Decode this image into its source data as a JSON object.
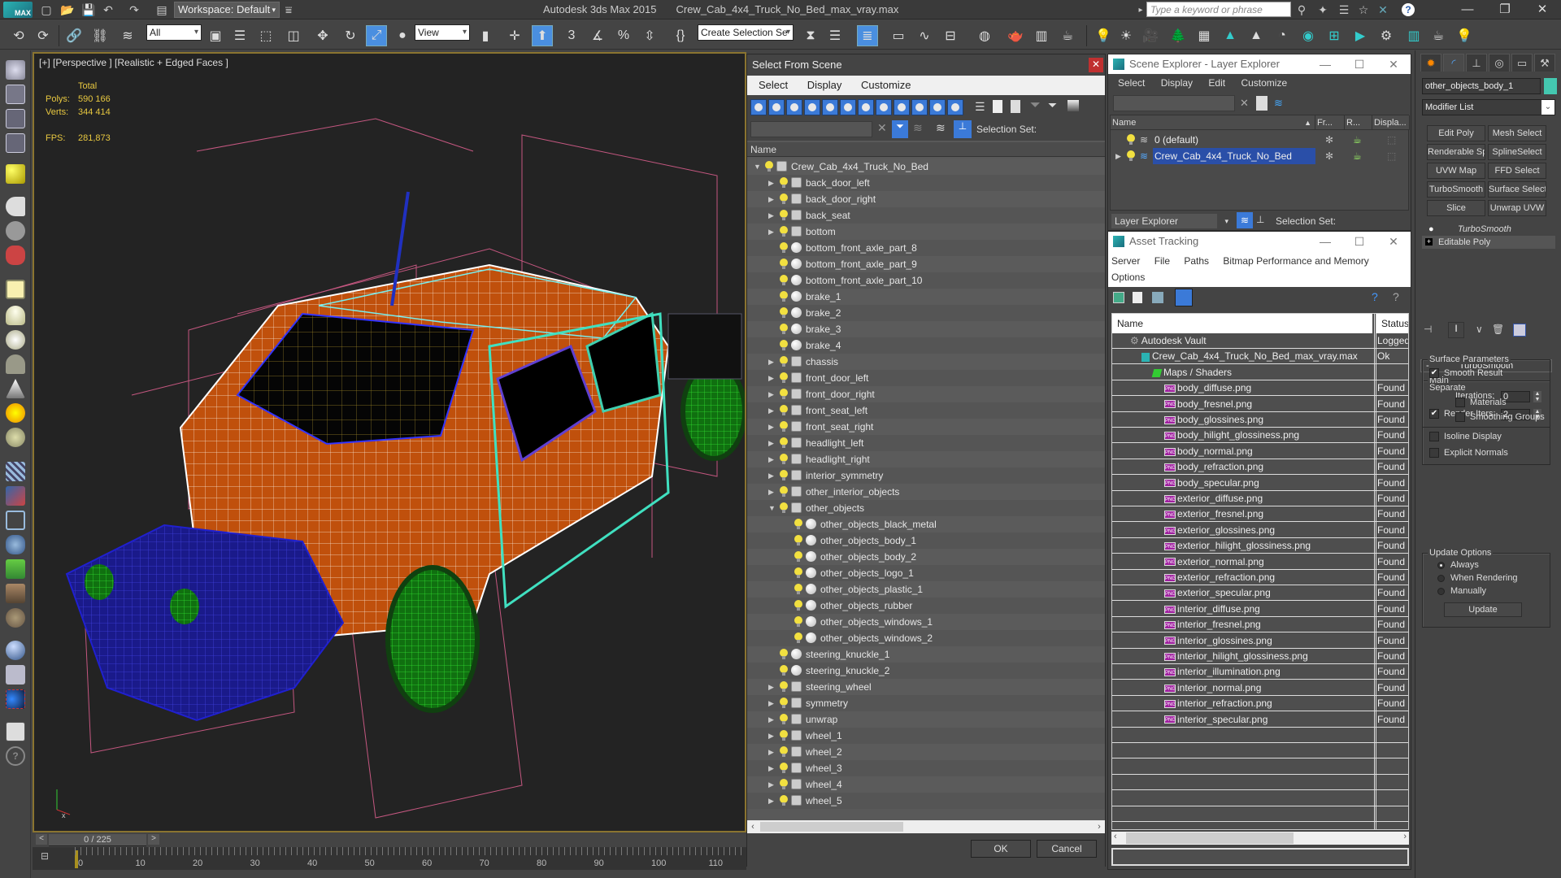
{
  "titlebar": {
    "workspace": "Workspace: Default",
    "app_name": "Autodesk 3ds Max  2015",
    "file_name": "Crew_Cab_4x4_Truck_No_Bed_max_vray.max",
    "search_placeholder": "Type a keyword or phrase",
    "logo_text": "MAX"
  },
  "toolbar": {
    "selection_filter": "All",
    "ref_coord": "View",
    "selection_set": "Create Selection Se"
  },
  "viewport": {
    "label": "[+] [Perspective ] [Realistic + Edged Faces ]",
    "stats_header": "Total",
    "polys_label": "Polys:",
    "polys_value": "590 166",
    "verts_label": "Verts:",
    "verts_value": "344 414",
    "fps_label": "FPS:",
    "fps_value": "281,873"
  },
  "timeline": {
    "frame_counter": "0 / 225",
    "ticks": [
      "0",
      "10",
      "20",
      "30",
      "40",
      "50",
      "60",
      "70",
      "80",
      "90",
      "100",
      "110"
    ]
  },
  "select_from_scene": {
    "title": "Select From Scene",
    "menu": [
      "Select",
      "Display",
      "Customize"
    ],
    "selection_set_label": "Selection Set:",
    "column_name": "Name",
    "ok_label": "OK",
    "cancel_label": "Cancel",
    "tree": [
      {
        "label": "Crew_Cab_4x4_Truck_No_Bed",
        "depth": 0,
        "expander": "open",
        "icon": "group"
      },
      {
        "label": "back_door_left",
        "depth": 1,
        "expander": "closed",
        "icon": "group"
      },
      {
        "label": "back_door_right",
        "depth": 1,
        "expander": "closed",
        "icon": "group"
      },
      {
        "label": "back_seat",
        "depth": 1,
        "expander": "closed",
        "icon": "group"
      },
      {
        "label": "bottom",
        "depth": 1,
        "expander": "closed",
        "icon": "group"
      },
      {
        "label": "bottom_front_axle_part_8",
        "depth": 1,
        "expander": "none",
        "icon": "sphere"
      },
      {
        "label": "bottom_front_axle_part_9",
        "depth": 1,
        "expander": "none",
        "icon": "sphere"
      },
      {
        "label": "bottom_front_axle_part_10",
        "depth": 1,
        "expander": "none",
        "icon": "sphere"
      },
      {
        "label": "brake_1",
        "depth": 1,
        "expander": "none",
        "icon": "sphere"
      },
      {
        "label": "brake_2",
        "depth": 1,
        "expander": "none",
        "icon": "sphere"
      },
      {
        "label": "brake_3",
        "depth": 1,
        "expander": "none",
        "icon": "sphere"
      },
      {
        "label": "brake_4",
        "depth": 1,
        "expander": "none",
        "icon": "sphere"
      },
      {
        "label": "chassis",
        "depth": 1,
        "expander": "closed",
        "icon": "group"
      },
      {
        "label": "front_door_left",
        "depth": 1,
        "expander": "closed",
        "icon": "group"
      },
      {
        "label": "front_door_right",
        "depth": 1,
        "expander": "closed",
        "icon": "group"
      },
      {
        "label": "front_seat_left",
        "depth": 1,
        "expander": "closed",
        "icon": "group"
      },
      {
        "label": "front_seat_right",
        "depth": 1,
        "expander": "closed",
        "icon": "group"
      },
      {
        "label": "headlight_left",
        "depth": 1,
        "expander": "closed",
        "icon": "group"
      },
      {
        "label": "headlight_right",
        "depth": 1,
        "expander": "closed",
        "icon": "group"
      },
      {
        "label": "interior_symmetry",
        "depth": 1,
        "expander": "closed",
        "icon": "group"
      },
      {
        "label": "other_interior_objects",
        "depth": 1,
        "expander": "closed",
        "icon": "group"
      },
      {
        "label": "other_objects",
        "depth": 1,
        "expander": "open",
        "icon": "group"
      },
      {
        "label": "other_objects_black_metal",
        "depth": 2,
        "expander": "none",
        "icon": "sphere"
      },
      {
        "label": "other_objects_body_1",
        "depth": 2,
        "expander": "none",
        "icon": "sphere"
      },
      {
        "label": "other_objects_body_2",
        "depth": 2,
        "expander": "none",
        "icon": "sphere"
      },
      {
        "label": "other_objects_logo_1",
        "depth": 2,
        "expander": "none",
        "icon": "sphere"
      },
      {
        "label": "other_objects_plastic_1",
        "depth": 2,
        "expander": "none",
        "icon": "sphere"
      },
      {
        "label": "other_objects_rubber",
        "depth": 2,
        "expander": "none",
        "icon": "sphere"
      },
      {
        "label": "other_objects_windows_1",
        "depth": 2,
        "expander": "none",
        "icon": "sphere"
      },
      {
        "label": "other_objects_windows_2",
        "depth": 2,
        "expander": "none",
        "icon": "sphere"
      },
      {
        "label": "steering_knuckle_1",
        "depth": 1,
        "expander": "none",
        "icon": "sphere"
      },
      {
        "label": "steering_knuckle_2",
        "depth": 1,
        "expander": "none",
        "icon": "sphere"
      },
      {
        "label": "steering_wheel",
        "depth": 1,
        "expander": "closed",
        "icon": "group"
      },
      {
        "label": "symmetry",
        "depth": 1,
        "expander": "closed",
        "icon": "group"
      },
      {
        "label": "unwrap",
        "depth": 1,
        "expander": "closed",
        "icon": "group"
      },
      {
        "label": "wheel_1",
        "depth": 1,
        "expander": "closed",
        "icon": "group"
      },
      {
        "label": "wheel_2",
        "depth": 1,
        "expander": "closed",
        "icon": "group"
      },
      {
        "label": "wheel_3",
        "depth": 1,
        "expander": "closed",
        "icon": "group"
      },
      {
        "label": "wheel_4",
        "depth": 1,
        "expander": "closed",
        "icon": "group"
      },
      {
        "label": "wheel_5",
        "depth": 1,
        "expander": "closed",
        "icon": "group"
      }
    ]
  },
  "scene_explorer": {
    "title": "Scene Explorer - Layer Explorer",
    "menu": [
      "Select",
      "Display",
      "Edit",
      "Customize"
    ],
    "columns": [
      "Name",
      "Fr...",
      "R...",
      "Displa..."
    ],
    "rows": [
      {
        "label": "0 (default)",
        "selected": false
      },
      {
        "label": "Crew_Cab_4x4_Truck_No_Bed",
        "selected": true
      }
    ],
    "layer_select": "Layer Explorer",
    "selection_set_label": "Selection Set:"
  },
  "asset_tracking": {
    "title": "Asset Tracking",
    "menu": [
      "Server",
      "File",
      "Paths",
      "Bitmap Performance and Memory",
      "Options"
    ],
    "columns": [
      "Name",
      "Status"
    ],
    "rows": [
      {
        "name": "Autodesk Vault",
        "status": "Logged",
        "depth": 0,
        "icon": "vault"
      },
      {
        "name": "Crew_Cab_4x4_Truck_No_Bed_max_vray.max",
        "status": "Ok",
        "depth": 1,
        "icon": "max"
      },
      {
        "name": "Maps / Shaders",
        "status": "",
        "depth": 2,
        "icon": "maps"
      },
      {
        "name": "body_diffuse.png",
        "status": "Found",
        "depth": 3,
        "icon": "png"
      },
      {
        "name": "body_fresnel.png",
        "status": "Found",
        "depth": 3,
        "icon": "png"
      },
      {
        "name": "body_glossines.png",
        "status": "Found",
        "depth": 3,
        "icon": "png"
      },
      {
        "name": "body_hilight_glossiness.png",
        "status": "Found",
        "depth": 3,
        "icon": "png"
      },
      {
        "name": "body_normal.png",
        "status": "Found",
        "depth": 3,
        "icon": "png"
      },
      {
        "name": "body_refraction.png",
        "status": "Found",
        "depth": 3,
        "icon": "png"
      },
      {
        "name": "body_specular.png",
        "status": "Found",
        "depth": 3,
        "icon": "png"
      },
      {
        "name": "exterior_diffuse.png",
        "status": "Found",
        "depth": 3,
        "icon": "png"
      },
      {
        "name": "exterior_fresnel.png",
        "status": "Found",
        "depth": 3,
        "icon": "png"
      },
      {
        "name": "exterior_glossines.png",
        "status": "Found",
        "depth": 3,
        "icon": "png"
      },
      {
        "name": "exterior_hilight_glossiness.png",
        "status": "Found",
        "depth": 3,
        "icon": "png"
      },
      {
        "name": "exterior_normal.png",
        "status": "Found",
        "depth": 3,
        "icon": "png"
      },
      {
        "name": "exterior_refraction.png",
        "status": "Found",
        "depth": 3,
        "icon": "png"
      },
      {
        "name": "exterior_specular.png",
        "status": "Found",
        "depth": 3,
        "icon": "png"
      },
      {
        "name": "interior_diffuse.png",
        "status": "Found",
        "depth": 3,
        "icon": "png"
      },
      {
        "name": "interior_fresnel.png",
        "status": "Found",
        "depth": 3,
        "icon": "png"
      },
      {
        "name": "interior_glossines.png",
        "status": "Found",
        "depth": 3,
        "icon": "png"
      },
      {
        "name": "interior_hilight_glossiness.png",
        "status": "Found",
        "depth": 3,
        "icon": "png"
      },
      {
        "name": "interior_illumination.png",
        "status": "Found",
        "depth": 3,
        "icon": "png"
      },
      {
        "name": "interior_normal.png",
        "status": "Found",
        "depth": 3,
        "icon": "png"
      },
      {
        "name": "interior_refraction.png",
        "status": "Found",
        "depth": 3,
        "icon": "png"
      },
      {
        "name": "interior_specular.png",
        "status": "Found",
        "depth": 3,
        "icon": "png"
      }
    ]
  },
  "command_panel": {
    "object_name": "other_objects_body_1",
    "object_color": "#44c8b0",
    "modifier_list": "Modifier List",
    "modifier_buttons": [
      "Edit Poly",
      "Mesh Select",
      "Renderable Spline",
      "SplineSelect",
      "UVW Map",
      "FFD Select",
      "TurboSmooth",
      "Surface Select",
      "Slice",
      "Unwrap UVW"
    ],
    "stack": [
      "TurboSmooth",
      "Editable Poly"
    ],
    "turbosmooth": {
      "title": "TurboSmooth",
      "main_group": "Main",
      "iterations_label": "Iterations:",
      "iterations_value": "0",
      "render_iters_label": "Render Iters:",
      "render_iters_value": "2",
      "render_iters_checked": true,
      "isoline_label": "Isoline Display",
      "isoline_checked": false,
      "explicit_normals_label": "Explicit Normals",
      "explicit_normals_checked": false,
      "surface_group": "Surface Parameters",
      "smooth_result_label": "Smooth Result",
      "smooth_result_checked": true,
      "separate_label": "Separate",
      "materials_label": "Materials",
      "smoothing_groups_label": "Smoothing Groups",
      "update_group": "Update Options",
      "update_options": [
        "Always",
        "When Rendering",
        "Manually"
      ],
      "update_selected": "Always",
      "update_button": "Update"
    }
  }
}
